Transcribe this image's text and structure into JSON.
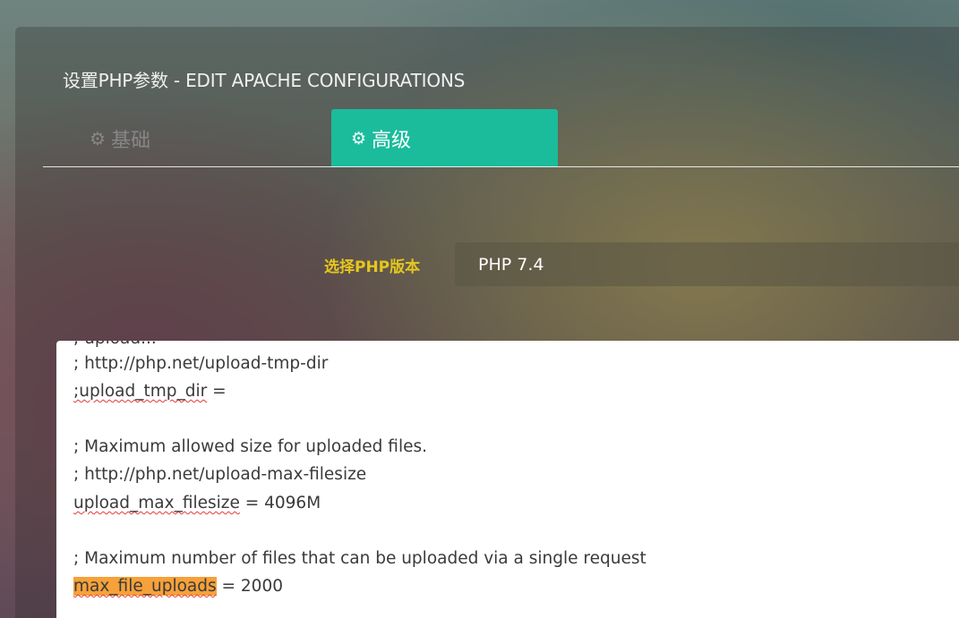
{
  "title": "设置PHP参数 - EDIT APACHE CONFIGURATIONS",
  "tabs": {
    "basic": {
      "label": "基础",
      "icon": "gear-icon"
    },
    "advanced": {
      "label": "高级",
      "icon": "gears-icon",
      "active": true
    }
  },
  "version": {
    "label": "选择PHP版本",
    "selected": "PHP 7.4"
  },
  "editor": {
    "partial_top": "; upload...",
    "lines": [
      {
        "text": "; http://php.net/upload-tmp-dir"
      },
      {
        "key": ";upload_tmp_dir",
        "rest": " ="
      },
      {
        "text": ""
      },
      {
        "text": "; Maximum allowed size for uploaded files."
      },
      {
        "text": "; http://php.net/upload-max-filesize"
      },
      {
        "key": "upload_max_filesize",
        "rest": " = 4096M"
      },
      {
        "text": ""
      },
      {
        "text": "; Maximum number of files that can be uploaded via a single request"
      },
      {
        "key": "max_file_uploads",
        "rest": " = 2000",
        "highlighted": true
      }
    ]
  },
  "colors": {
    "accent": "#1abc9c",
    "label_yellow": "#e4c61e",
    "highlight": "#f6a13a",
    "spell_error": "#e23b3b"
  }
}
